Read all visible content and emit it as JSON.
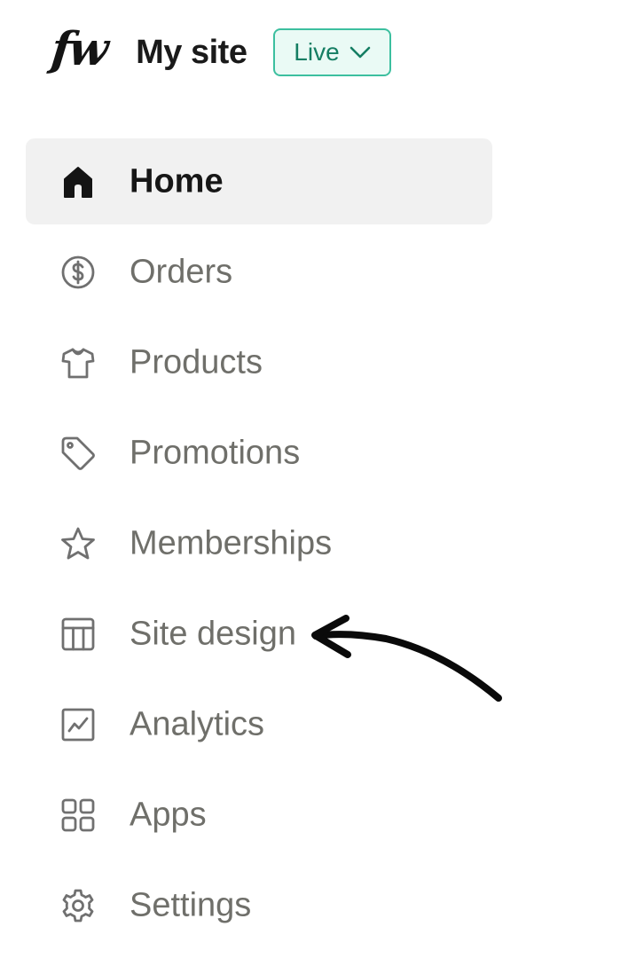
{
  "header": {
    "logo_text": "fw",
    "site_title": "My site",
    "status_badge": {
      "label": "Live",
      "border_color": "#3cbf9f",
      "text_color": "#157e63"
    }
  },
  "nav": {
    "items": [
      {
        "label": "Home",
        "icon": "home-icon",
        "active": true
      },
      {
        "label": "Orders",
        "icon": "dollar-circle-icon",
        "active": false
      },
      {
        "label": "Products",
        "icon": "tshirt-icon",
        "active": false
      },
      {
        "label": "Promotions",
        "icon": "tag-icon",
        "active": false
      },
      {
        "label": "Memberships",
        "icon": "star-icon",
        "active": false
      },
      {
        "label": "Site design",
        "icon": "layout-icon",
        "active": false
      },
      {
        "label": "Analytics",
        "icon": "chart-icon",
        "active": false
      },
      {
        "label": "Apps",
        "icon": "grid-icon",
        "active": false
      },
      {
        "label": "Settings",
        "icon": "gear-icon",
        "active": false
      }
    ]
  },
  "annotation": {
    "type": "hand-drawn-arrow",
    "points_to": "Site design"
  },
  "colors": {
    "active_bg": "#f1f1f1",
    "active_text": "#161616",
    "inactive_text": "#6f6f6a"
  }
}
